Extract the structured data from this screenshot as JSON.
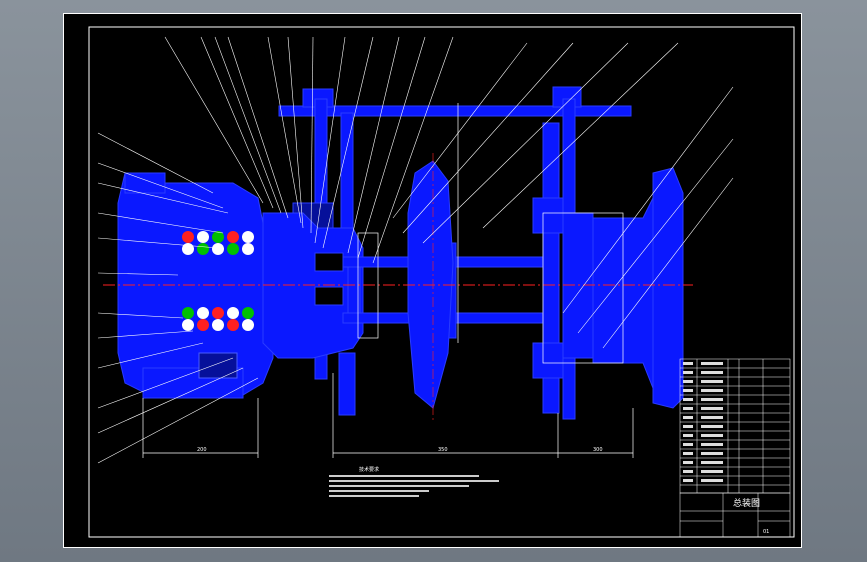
{
  "colors": {
    "window_bg": "#7b848d",
    "sheet_bg": "#000000",
    "frame": "#ffffff",
    "part_blue": "#0a18ff",
    "centerline": "#ff2020",
    "bearing_green": "#00c000",
    "bearing_red": "#ff2020",
    "bearing_white": "#ffffff"
  },
  "drawing": {
    "dimension_labels": [
      "200",
      "350",
      "300"
    ],
    "notes_heading": "技术要求"
  },
  "title_block": {
    "title": "总装图",
    "drawing_number": "01"
  }
}
